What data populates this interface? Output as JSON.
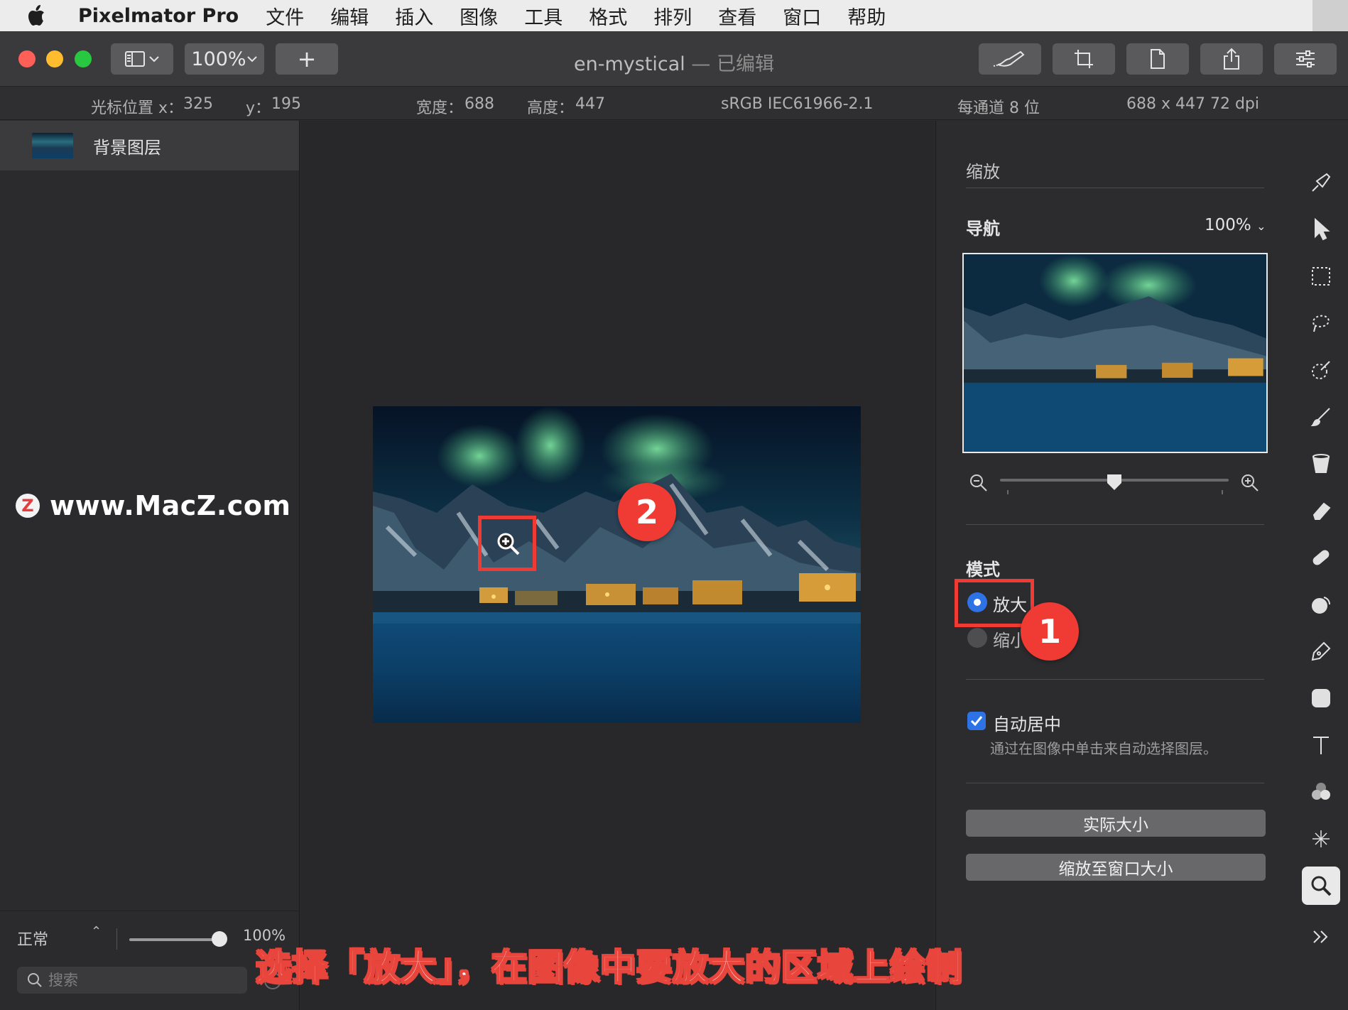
{
  "menubar": {
    "app_name": "Pixelmator Pro",
    "items": [
      "文件",
      "编辑",
      "插入",
      "图像",
      "工具",
      "格式",
      "排列",
      "查看",
      "窗口",
      "帮助"
    ]
  },
  "toolbar": {
    "zoom_value": "100%",
    "add_label": "+",
    "doc_title": "en-mystical",
    "edited_suffix": " — 已编辑"
  },
  "infobar": {
    "cursor_x_label": "光标位置 x：",
    "cursor_x": "325",
    "cursor_y_label": "y：",
    "cursor_y": "195",
    "width_label": "宽度：",
    "width": "688",
    "height_label": "高度：",
    "height": "447",
    "color_profile": "sRGB IEC61966-2.1",
    "bit_depth": "每通道 8 位",
    "resolution": "688 x 447 72 dpi"
  },
  "layers": {
    "items": [
      {
        "name": "背景图层"
      }
    ],
    "blend_mode": "正常",
    "opacity": "100%",
    "opacity_fraction": 1.0,
    "search_placeholder": "搜索"
  },
  "watermark": {
    "logo_letter": "Z",
    "text": "www.MacZ.com"
  },
  "annotations": {
    "step1": "1",
    "step2": "2",
    "caption": "选择「放大」，在图像中要放大的区域上绘制"
  },
  "zoom_panel": {
    "title": "缩放",
    "nav_label": "导航",
    "nav_zoom": "100%",
    "zoom_slider_fraction": 0.5,
    "mode_label": "模式",
    "mode_options": [
      "放大",
      "缩小"
    ],
    "selected_mode": "放大",
    "auto_center_label": "自动居中",
    "auto_center_desc": "通过在图像中单击来自动选择图层。",
    "auto_center_checked": true,
    "actual_size_button": "实际大小",
    "fit_window_button": "缩放至窗口大小"
  },
  "tools": [
    "paint-icon",
    "arrange-icon",
    "selection-icon",
    "lasso-icon",
    "quick-select-icon",
    "brush-icon",
    "fill-icon",
    "eraser-icon",
    "repair-icon",
    "effects-icon",
    "pen-icon",
    "shape-icon",
    "text-icon",
    "color-adjust-icon",
    "distort-icon",
    "zoom-icon",
    "more-icon"
  ],
  "colors": {
    "accent_blue": "#2e73e6",
    "annotation_red": "#ef3b33"
  }
}
